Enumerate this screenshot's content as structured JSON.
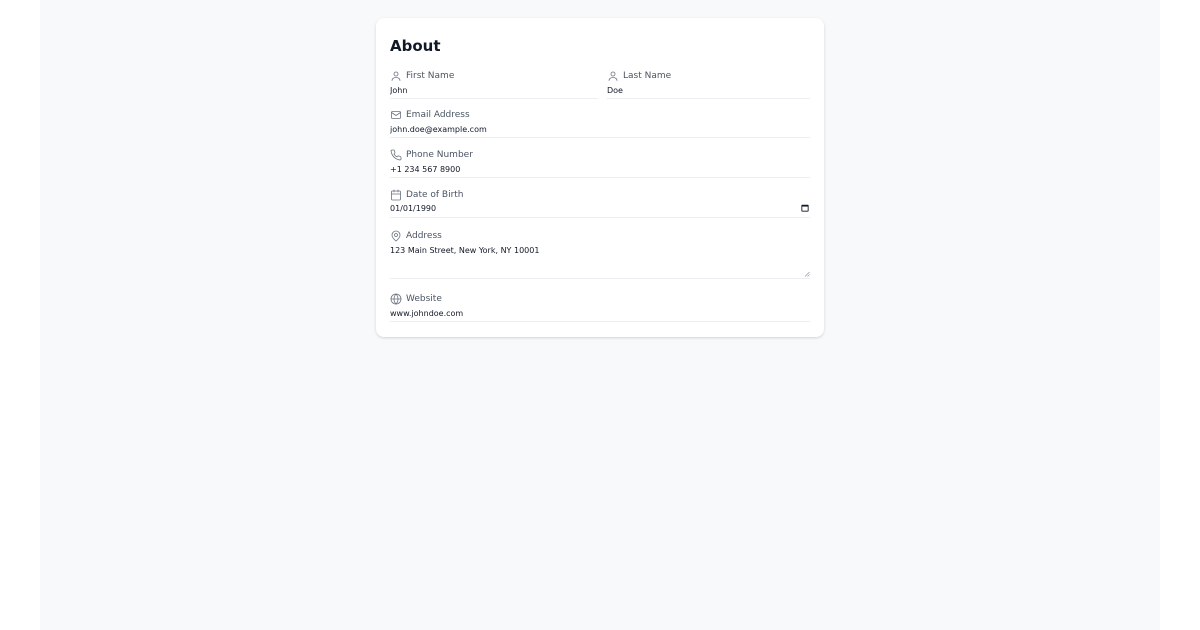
{
  "card": {
    "title": "About"
  },
  "fields": {
    "first_name": {
      "label": "First Name",
      "value": "John",
      "icon": "user-icon"
    },
    "last_name": {
      "label": "Last Name",
      "value": "Doe",
      "icon": "user-icon"
    },
    "email": {
      "label": "Email Address",
      "value": "john.doe@example.com",
      "icon": "mail-icon"
    },
    "phone": {
      "label": "Phone Number",
      "value": "+1 234 567 8900",
      "icon": "phone-icon"
    },
    "dob": {
      "label": "Date of Birth",
      "value": "01/01/1990",
      "icon": "calendar-icon"
    },
    "address": {
      "label": "Address",
      "value": "123 Main Street, New York, NY 10001",
      "icon": "map-pin-icon"
    },
    "website": {
      "label": "Website",
      "value": "www.johndoe.com",
      "icon": "globe-icon"
    }
  },
  "colors": {
    "background": "#f8f9fb",
    "card": "#ffffff",
    "label": "#4b5563",
    "text": "#111827",
    "icon": "#6b7280",
    "divider": "#eceef1"
  }
}
